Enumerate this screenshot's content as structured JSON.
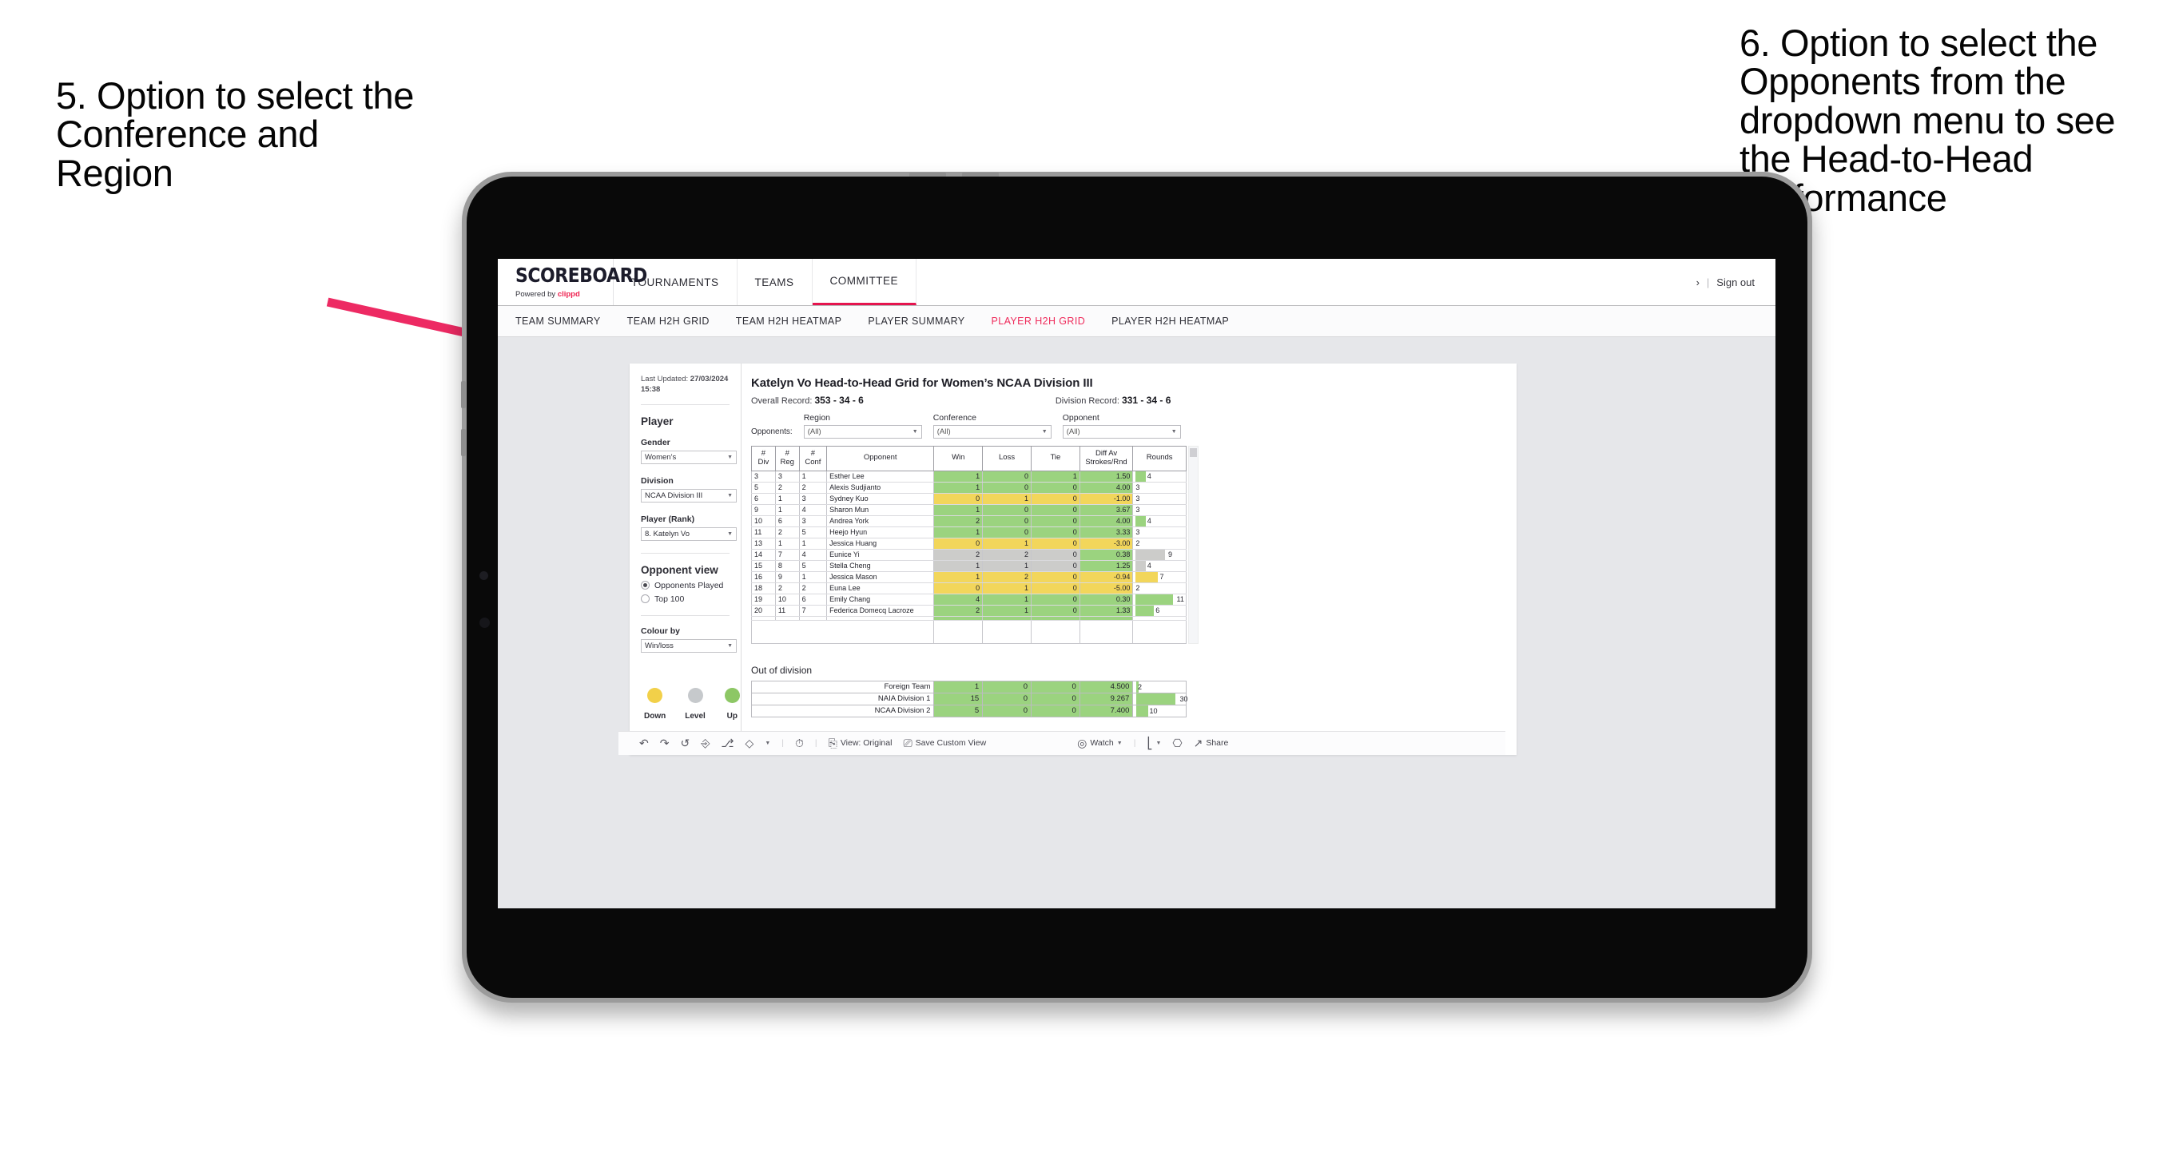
{
  "annotations": {
    "left": "5. Option to select the Conference and Region",
    "right": "6. Option to select the Opponents from the dropdown menu to see the Head-to-Head performance",
    "arrow_color": "#ED2A63"
  },
  "app": {
    "logo": {
      "main": "SCOREBOARD",
      "powered_prefix": "Powered by ",
      "brand": "clippd"
    },
    "topnav": [
      {
        "label": "TOURNAMENTS",
        "active": false
      },
      {
        "label": "TEAMS",
        "active": false
      },
      {
        "label": "COMMITTEE",
        "active": true
      }
    ],
    "account": {
      "chevron": "›",
      "separator": "|",
      "signout": "Sign out"
    },
    "subnav": [
      {
        "label": "TEAM SUMMARY",
        "active": false
      },
      {
        "label": "TEAM H2H GRID",
        "active": false
      },
      {
        "label": "TEAM H2H HEATMAP",
        "active": false
      },
      {
        "label": "PLAYER SUMMARY",
        "active": false
      },
      {
        "label": "PLAYER H2H GRID",
        "active": true
      },
      {
        "label": "PLAYER H2H HEATMAP",
        "active": false
      }
    ]
  },
  "sidebar": {
    "last_updated_label": "Last Updated: ",
    "last_updated_value": "27/03/2024",
    "last_updated_time": "15:38",
    "section_title": "Player",
    "filters": [
      {
        "label": "Gender",
        "value": "Women’s"
      },
      {
        "label": "Division",
        "value": "NCAA Division III"
      },
      {
        "label": "Player (Rank)",
        "value": "8. Katelyn Vo"
      }
    ],
    "opponent_view": {
      "title": "Opponent view",
      "options": [
        {
          "label": "Opponents Played",
          "selected": true
        },
        {
          "label": "Top 100",
          "selected": false
        }
      ]
    },
    "colour_by": {
      "label": "Colour by",
      "value": "Win/loss"
    },
    "legend": [
      {
        "label": "Down",
        "color": "#F2D049"
      },
      {
        "label": "Level",
        "color": "#C6C9CC"
      },
      {
        "label": "Up",
        "color": "#8DC765"
      }
    ]
  },
  "main": {
    "title": "Katelyn Vo Head-to-Head Grid for Women’s NCAA Division III",
    "overall_record_label": "Overall Record: ",
    "overall_record_value": "353 - 34 - 6",
    "division_record_label": "Division Record: ",
    "division_record_value": "331 - 34 - 6",
    "opponents_label": "Opponents:",
    "dropdowns": [
      {
        "caption": "Region",
        "value": "(All)"
      },
      {
        "caption": "Conference",
        "value": "(All)"
      },
      {
        "caption": "Opponent",
        "value": "(All)"
      }
    ],
    "out_of_division_title": "Out of division"
  },
  "toolbar": {
    "icons": [
      "undo-icon",
      "redo-icon",
      "revert-icon",
      "refresh-icon",
      "pause-icon",
      "highlight-icon"
    ],
    "view_label": "View: Original",
    "save_view_label": "Save Custom View",
    "watch_label": "Watch",
    "share_label": "Share"
  },
  "chart_data": {
    "type": "table",
    "title": "Katelyn Vo Head-to-Head Grid for Women’s NCAA Division III",
    "columns": [
      "# Div",
      "# Reg",
      "# Conf",
      "Opponent",
      "Win",
      "Loss",
      "Tie",
      "Diff Av Strokes/Rnd",
      "Rounds"
    ],
    "column_headers_two_line": [
      {
        "top": "#",
        "bottom": "Div"
      },
      {
        "top": "#",
        "bottom": "Reg"
      },
      {
        "top": "#",
        "bottom": "Conf"
      },
      {
        "top": "",
        "bottom": "Opponent"
      },
      {
        "top": "",
        "bottom": "Win"
      },
      {
        "top": "",
        "bottom": "Loss"
      },
      {
        "top": "",
        "bottom": "Tie"
      },
      {
        "top": "Diff Av",
        "bottom": "Strokes/Rnd"
      },
      {
        "top": "",
        "bottom": "Rounds"
      }
    ],
    "rows": [
      {
        "div": "3",
        "reg": "3",
        "conf": "1",
        "opponent": "Esther Lee",
        "win": "1",
        "loss": "0",
        "tie": "1",
        "diff": "1.50",
        "rounds": "4",
        "rounds_pct": 22,
        "color": "#9BD37F"
      },
      {
        "div": "5",
        "reg": "2",
        "conf": "2",
        "opponent": "Alexis Sudjianto",
        "win": "1",
        "loss": "0",
        "tie": "0",
        "diff": "4.00",
        "rounds": "3",
        "rounds_pct": 0,
        "color": "#9BD37F"
      },
      {
        "div": "6",
        "reg": "1",
        "conf": "3",
        "opponent": "Sydney Kuo",
        "win": "0",
        "loss": "1",
        "tie": "0",
        "diff": "-1.00",
        "rounds": "3",
        "rounds_pct": 0,
        "color": "#F2D65B"
      },
      {
        "div": "9",
        "reg": "1",
        "conf": "4",
        "opponent": "Sharon Mun",
        "win": "1",
        "loss": "0",
        "tie": "0",
        "diff": "3.67",
        "rounds": "3",
        "rounds_pct": 0,
        "color": "#9BD37F"
      },
      {
        "div": "10",
        "reg": "6",
        "conf": "3",
        "opponent": "Andrea York",
        "win": "2",
        "loss": "0",
        "tie": "0",
        "diff": "4.00",
        "rounds": "4",
        "rounds_pct": 22,
        "color": "#9BD37F"
      },
      {
        "div": "11",
        "reg": "2",
        "conf": "5",
        "opponent": "Heejo Hyun",
        "win": "1",
        "loss": "0",
        "tie": "0",
        "diff": "3.33",
        "rounds": "3",
        "rounds_pct": 0,
        "color": "#9BD37F"
      },
      {
        "div": "13",
        "reg": "1",
        "conf": "1",
        "opponent": "Jessica Huang",
        "win": "0",
        "loss": "1",
        "tie": "0",
        "diff": "-3.00",
        "rounds": "2",
        "rounds_pct": 0,
        "color": "#F2D65B"
      },
      {
        "div": "14",
        "reg": "7",
        "conf": "4",
        "opponent": "Eunice Yi",
        "win": "2",
        "loss": "2",
        "tie": "0",
        "diff": "0.38",
        "rounds": "9",
        "rounds_pct": 62,
        "color": "#CCCCCA",
        "diff_color": "#9BD37F"
      },
      {
        "div": "15",
        "reg": "8",
        "conf": "5",
        "opponent": "Stella Cheng",
        "win": "1",
        "loss": "1",
        "tie": "0",
        "diff": "1.25",
        "rounds": "4",
        "rounds_pct": 22,
        "color": "#CCCCCA",
        "diff_color": "#9BD37F"
      },
      {
        "div": "16",
        "reg": "9",
        "conf": "1",
        "opponent": "Jessica Mason",
        "win": "1",
        "loss": "2",
        "tie": "0",
        "diff": "-0.94",
        "rounds": "7",
        "rounds_pct": 46,
        "color": "#F2D65B"
      },
      {
        "div": "18",
        "reg": "2",
        "conf": "2",
        "opponent": "Euna Lee",
        "win": "0",
        "loss": "1",
        "tie": "0",
        "diff": "-5.00",
        "rounds": "2",
        "rounds_pct": 0,
        "color": "#F2D65B"
      },
      {
        "div": "19",
        "reg": "10",
        "conf": "6",
        "opponent": "Emily Chang",
        "win": "4",
        "loss": "1",
        "tie": "0",
        "diff": "0.30",
        "rounds": "11",
        "rounds_pct": 78,
        "color": "#9BD37F"
      },
      {
        "div": "20",
        "reg": "11",
        "conf": "7",
        "opponent": "Federica Domecq Lacroze",
        "win": "2",
        "loss": "1",
        "tie": "0",
        "diff": "1.33",
        "rounds": "6",
        "rounds_pct": 38,
        "color": "#9BD37F"
      }
    ],
    "out_of_division": {
      "title": "Out of division",
      "rows": [
        {
          "name": "Foreign Team",
          "win": "1",
          "loss": "0",
          "tie": "0",
          "diff": "4.500",
          "rounds": "2",
          "rounds_pct": 4,
          "color": "#9BD37F"
        },
        {
          "name": "NAIA Division 1",
          "win": "15",
          "loss": "0",
          "tie": "0",
          "diff": "9.267",
          "rounds": "30",
          "rounds_pct": 84,
          "color": "#9BD37F"
        },
        {
          "name": "NCAA Division 2",
          "win": "5",
          "loss": "0",
          "tie": "0",
          "diff": "7.400",
          "rounds": "10",
          "rounds_pct": 26,
          "color": "#9BD37F"
        }
      ]
    }
  }
}
